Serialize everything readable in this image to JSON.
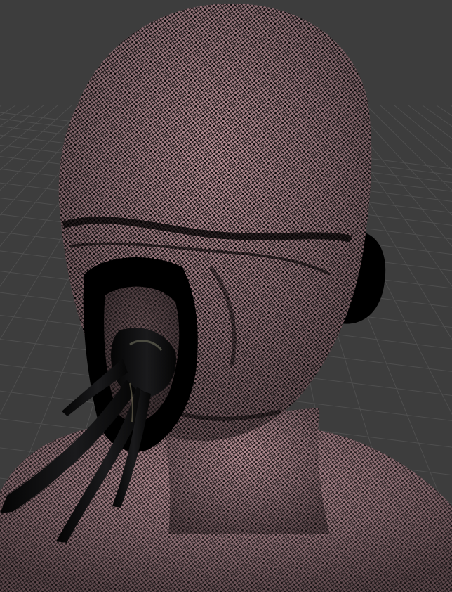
{
  "viewport": {
    "background_color": "#3d3d3d",
    "grid_color": "#4f4f4f",
    "skin_base_color": "#8d6d73",
    "skin_highlight_color": "#b98f95",
    "wire_color": "#111111",
    "shadow_color": "#000000",
    "tendril_color": "#0b0b0c",
    "tendril_highlight_color": "#5a5a4c"
  },
  "mode": {
    "shading": "textured-wireframe-overlay",
    "show_grid": true
  }
}
